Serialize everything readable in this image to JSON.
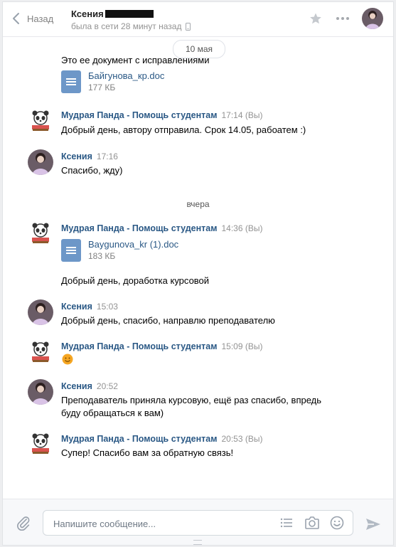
{
  "header": {
    "back_label": "Назад",
    "peer_name": "Ксения",
    "peer_status": "была в сети 28 минут назад"
  },
  "date_pill": "10 мая",
  "day_separator": "вчера",
  "messages": [
    {
      "text": "Это ее документ с исправлениями",
      "doc": {
        "name": "Байгунова_кр.doc",
        "size": "177 КБ"
      }
    },
    {
      "author": "Мудрая Панда - Помощь студентам",
      "time": "17:14 (Вы)",
      "text": "Добрый день, автору отправила. Срок 14.05, рабоатем :)"
    },
    {
      "author": "Ксения",
      "time": "17:16",
      "text": "Спасибо, жду)"
    },
    {
      "author": "Мудрая Панда - Помощь студентам",
      "time": "14:36 (Вы)",
      "doc": {
        "name": "Baygunova_kr (1).doc",
        "size": "183 КБ"
      },
      "text": "Добрый день, доработка курсовой"
    },
    {
      "author": "Ксения",
      "time": "15:03",
      "text": "Добрый день, спасибо, направлю преподавателю"
    },
    {
      "author": "Мудрая Панда - Помощь студентам",
      "time": "15:09 (Вы)",
      "emoji": "smiling-face-emoji"
    },
    {
      "author": "Ксения",
      "time": "20:52",
      "text_line1": "Преподаватель приняла курсовую, ещё раз спасибо, впредь",
      "text_line2": "буду обращаться к вам)"
    },
    {
      "author": "Мудрая Панда - Помощь студентам",
      "time": "20:53 (Вы)",
      "text": "Супер! Спасибо вам за обратную связь!"
    }
  ],
  "composer": {
    "placeholder": "Напишите сообщение..."
  },
  "colors": {
    "link": "#2a5885",
    "doc_icon": "#6d97c8",
    "muted": "#939393"
  }
}
